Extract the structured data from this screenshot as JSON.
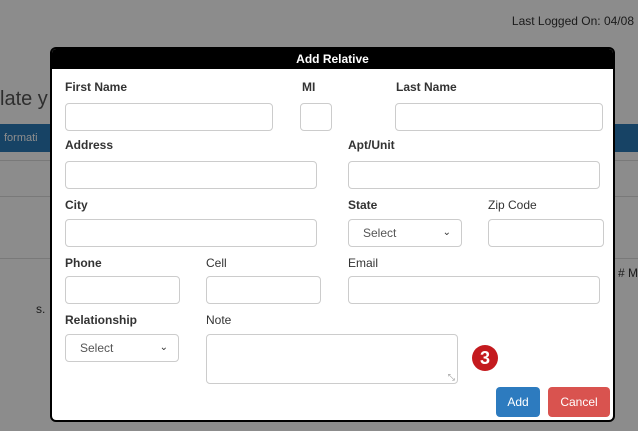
{
  "background": {
    "last_logged": "Last Logged On: 04/08",
    "heading_fragment": "late y",
    "tab_fragment": "formati",
    "right_fragment": "# M",
    "left_fragment": "s."
  },
  "modal": {
    "title": "Add Relative",
    "labels": {
      "first_name": "First Name",
      "mi": "MI",
      "last_name": "Last Name",
      "address": "Address",
      "apt_unit": "Apt/Unit",
      "city": "City",
      "state": "State",
      "zip_code": "Zip Code",
      "phone": "Phone",
      "cell": "Cell",
      "email": "Email",
      "relationship": "Relationship",
      "note": "Note"
    },
    "state_select": {
      "selected": "Select"
    },
    "relationship_select": {
      "selected": "Select"
    },
    "buttons": {
      "add": "Add",
      "cancel": "Cancel"
    },
    "step_badge": "3"
  },
  "colors": {
    "add": "#2d7bbf",
    "cancel": "#d9534f",
    "badge": "#c41a1e",
    "header": "#000000"
  }
}
